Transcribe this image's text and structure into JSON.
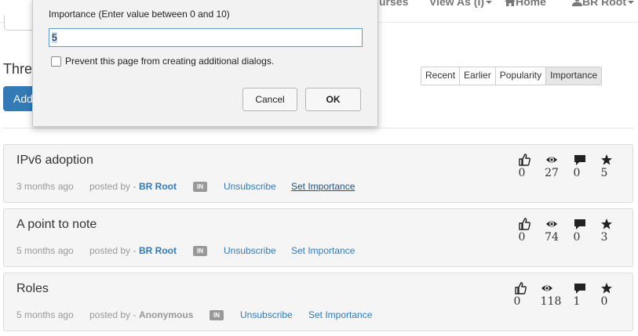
{
  "navbar": {
    "courses_label": "urses",
    "view_as_label": "View As (I)",
    "home_label": "Home",
    "user_label": "BR Root"
  },
  "page": {
    "title_partial": "Thre",
    "add_button_partial": "Add"
  },
  "sort_tabs": [
    "Recent",
    "Earlier",
    "Popularity",
    "Importance"
  ],
  "sort_active": "Importance",
  "threads": [
    {
      "title": "IPv6 adoption",
      "age": "3 months ago",
      "posted_by": "posted by -",
      "author": "BR Root",
      "badge": "IN",
      "unsubscribe": "Unsubscribe",
      "set_importance": "Set Importance",
      "likes": "0",
      "views": "27",
      "comments": "0",
      "importance": "5"
    },
    {
      "title": "A point to note",
      "age": "5 months ago",
      "posted_by": "posted by -",
      "author": "BR Root",
      "badge": "IN",
      "unsubscribe": "Unsubscribe",
      "set_importance": "Set Importance",
      "likes": "0",
      "views": "74",
      "comments": "0",
      "importance": "3"
    },
    {
      "title": "Roles",
      "age": "5 months ago",
      "posted_by": "posted by -",
      "author": "Anonymous",
      "badge": "IN",
      "unsubscribe": "Unsubscribe",
      "set_importance": "Set Importance",
      "likes": "0",
      "views": "118",
      "comments": "1",
      "importance": "0"
    }
  ],
  "icons": {
    "likes": "thumbs-up-icon",
    "views": "eye-icon",
    "comments": "comment-icon",
    "importance": "star-icon"
  },
  "dialog": {
    "message": "Importance (Enter value between 0 and 10)",
    "input_value": "5",
    "checkbox_label": "Prevent this page from creating additional dialogs.",
    "cancel_label": "Cancel",
    "ok_label": "OK"
  },
  "colors": {
    "primary": "#337ab7",
    "badge": "#999999",
    "card_bg": "#f5f5f5"
  }
}
